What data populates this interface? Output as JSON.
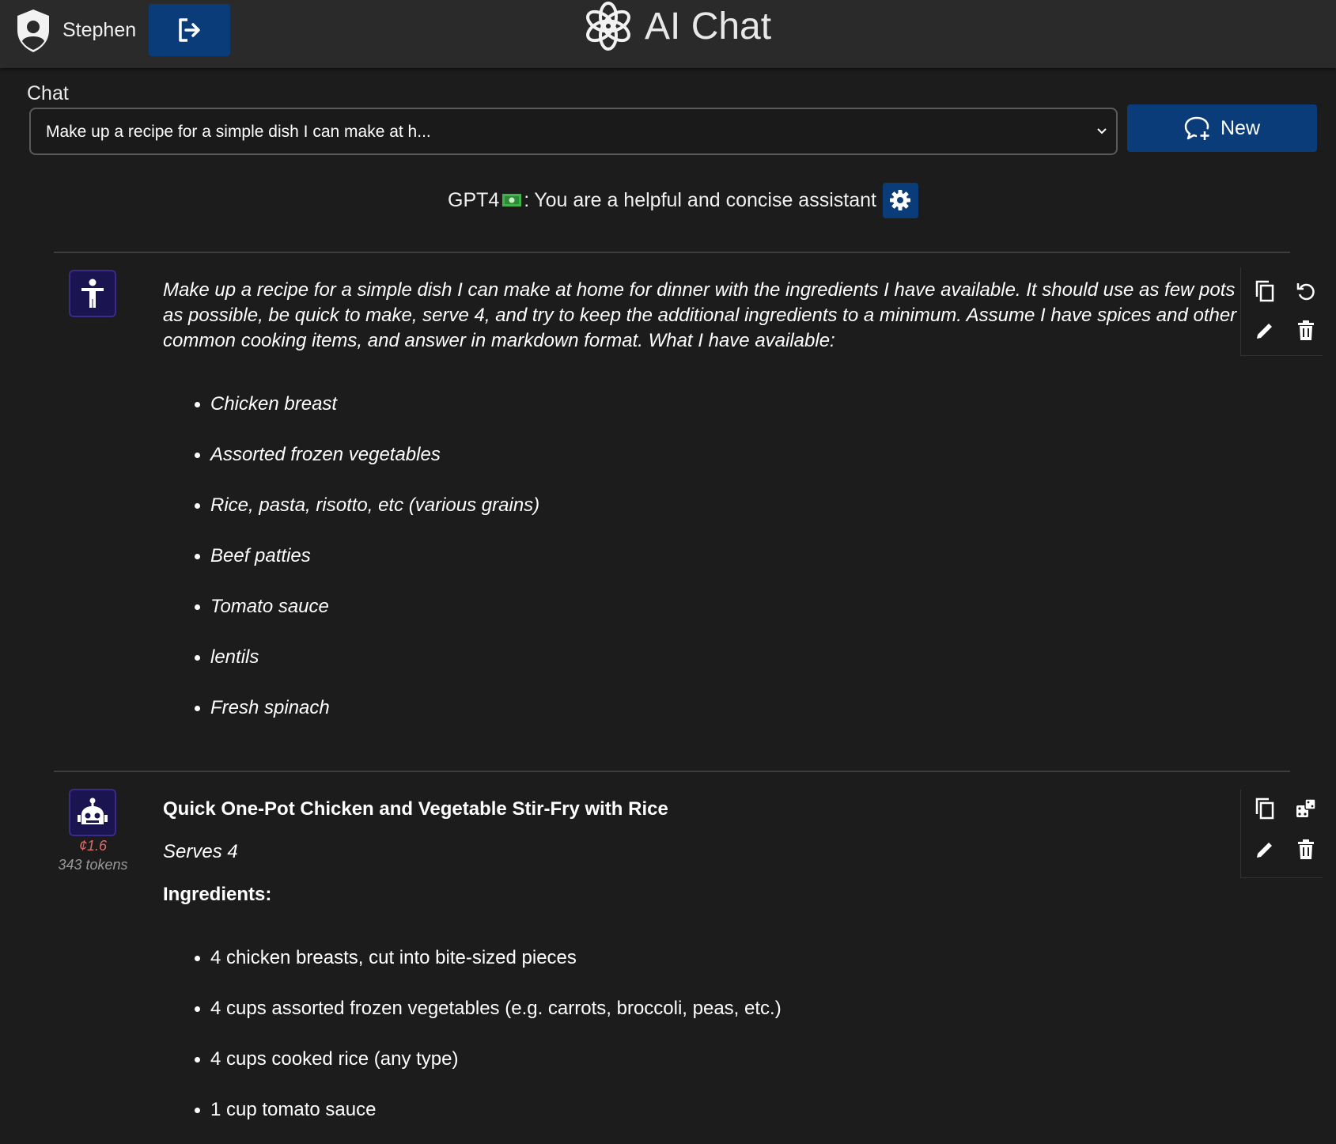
{
  "header": {
    "user_name": "Stephen",
    "app_title": "AI Chat",
    "user_icon": "shield-user-icon",
    "logout_icon": "logout-icon",
    "logo_icon": "openai-logo-icon",
    "accent_color": "#0b3c7a"
  },
  "chat_picker": {
    "label": "Chat",
    "selected": "Make up a recipe for a simple dish I can make at h...",
    "new_button_label": "New"
  },
  "model_bar": {
    "model": "GPT4",
    "separator": ":",
    "system_prompt": "You are a helpful and concise assistant"
  },
  "messages": [
    {
      "role": "user",
      "text": "Make up a recipe for a simple dish I can make at home for dinner with the ingredients I have available.  It should use as few pots as possible, be quick to make, serve 4, and try to keep the additional ingredients to a minimum.  Assume I have spices and other common cooking items, and answer in markdown format.  What I have available:",
      "items": [
        "Chicken breast",
        "Assorted frozen vegetables",
        "Rice, pasta, risotto, etc (various grains)",
        "Beef patties",
        "Tomato sauce",
        "lentils",
        "Fresh spinach"
      ]
    },
    {
      "role": "assistant",
      "cost": "¢1.6",
      "tokens": "343 tokens",
      "heading": "Quick One-Pot Chicken and Vegetable Stir-Fry with Rice",
      "serves": "Serves 4",
      "ingredients_label": "Ingredients:",
      "items": [
        "4 chicken breasts, cut into bite-sized pieces",
        "4 cups assorted frozen vegetables (e.g. carrots, broccoli, peas, etc.)",
        "4 cups cooked rice (any type)",
        "1 cup tomato sauce"
      ]
    }
  ]
}
